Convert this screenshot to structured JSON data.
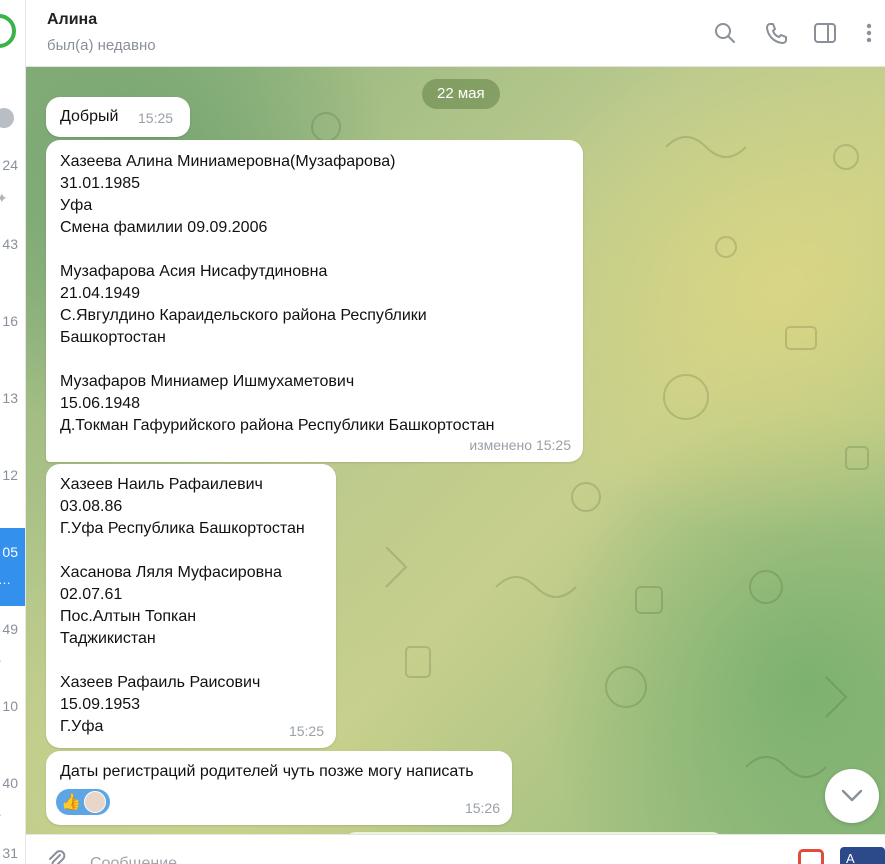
{
  "header": {
    "title": "Алина",
    "status": "был(а) недавно",
    "icons": [
      "search-icon",
      "phone-icon",
      "sidebar-toggle-icon",
      "more-vertical-icon"
    ]
  },
  "chat_list_fragment": {
    "counts": [
      "24",
      "43",
      "16",
      "13",
      "12",
      "05",
      "49",
      "10",
      "40",
      "31"
    ]
  },
  "chat": {
    "date": "22 мая",
    "messages": [
      {
        "text": "Добрый",
        "time": "15:25"
      },
      {
        "lines": [
          "Хазеева Алина Миниамеровна(Музафарова)",
          "31.01.1985",
          "Уфа",
          "Смена фамилии 09.09.2006",
          "",
          "Музафарова Асия Нисафутдиновна",
          "21.04.1949",
          "С.Явгулдино Караидельского района Республики",
          "Башкортостан",
          "",
          "Музафаров Миниамер Ишмухаметович",
          "15.06.1948",
          "Д.Токман Гафурийского района Республики Башкортостан"
        ],
        "time": "изменено 15:25"
      },
      {
        "lines": [
          "Хазеев Наиль Рафаилевич",
          "03.08.86",
          "Г.Уфа Республика Башкортостан",
          "",
          "Хасанова Ляля Муфасировна",
          "02.07.61",
          "Пос.Алтын Топкан",
          "Таджикистан",
          "",
          "Хазеев Рафаиль Раисович",
          "15.09.1953",
          "Г.Уфа"
        ],
        "time": "15:25"
      },
      {
        "text": "Даты регистраций родителей чуть позже могу написать",
        "time": "15:26",
        "reaction": "👍"
      }
    ]
  },
  "composer": {
    "placeholder": "Сообщение"
  },
  "tray": {
    "app2_label": "A"
  }
}
